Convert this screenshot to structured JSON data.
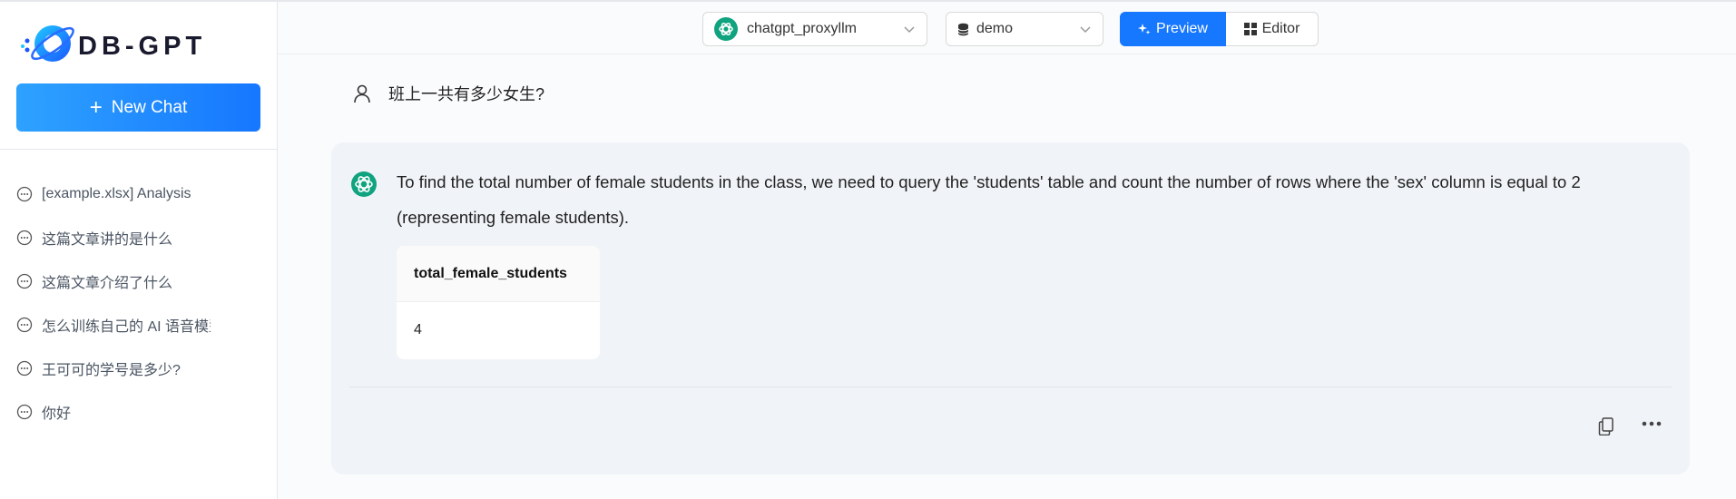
{
  "app": {
    "logo_text": "DB-GPT",
    "accent_color": "#1677ff"
  },
  "sidebar": {
    "new_chat_label": "New Chat",
    "history": [
      {
        "label": "[example.xlsx] Analysis",
        "icon": "chat-bubble-icon"
      },
      {
        "label": "这篇文章讲的是什么",
        "icon": "chat-bubble-icon"
      },
      {
        "label": "这篇文章介绍了什么",
        "icon": "chat-bubble-icon"
      },
      {
        "label": "怎么训练自己的 AI 语音模型",
        "icon": "chat-bubble-icon"
      },
      {
        "label": "王可可的学号是多少?",
        "icon": "chat-bubble-icon"
      },
      {
        "label": "你好",
        "icon": "chat-bubble-icon"
      }
    ]
  },
  "toolbar": {
    "model_value": "chatgpt_proxyllm",
    "db_value": "demo",
    "preview_label": "Preview",
    "editor_label": "Editor"
  },
  "conversation": {
    "user_question": "班上一共有多少女生?",
    "assistant_answer": "To find the total number of female students in the class, we need to query the 'students' table and count the number of rows where the 'sex' column is equal to 2 (representing female students).",
    "result_table": {
      "columns": [
        "total_female_students"
      ],
      "rows": [
        [
          "4"
        ]
      ]
    }
  }
}
